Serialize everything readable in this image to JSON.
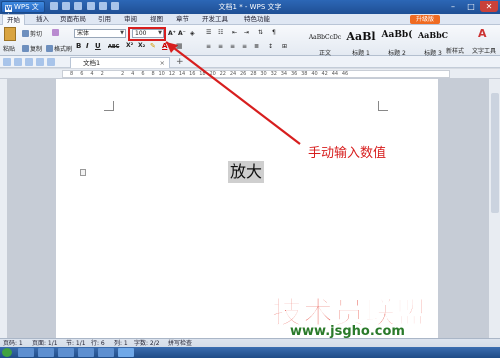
{
  "app": {
    "button_label": "WPS 文字",
    "document_title": "文档1 * - WPS 文字"
  },
  "window_controls": {
    "minimize": "–",
    "maximize": "□",
    "close": "✕"
  },
  "ribbon_tabs": [
    "开始",
    "插入",
    "页面布局",
    "引用",
    "审阅",
    "视图",
    "章节",
    "开发工具",
    "特色功能"
  ],
  "upgrade_label": "升级版",
  "clipboard": {
    "paste": "粘贴",
    "cut": "剪切",
    "copy": "复制",
    "format_painter": "格式刷"
  },
  "font": {
    "name": "宋体",
    "size": "100"
  },
  "format_buttons": [
    "B",
    "I",
    "U",
    "ABC",
    "X²",
    "X₂",
    "A"
  ],
  "styles": [
    {
      "sample": "AaBbCcDc",
      "label": "正文"
    },
    {
      "sample": "AaBl",
      "label": "标题 1"
    },
    {
      "sample": "AaBb(",
      "label": "标题 2"
    },
    {
      "sample": "AaBbC",
      "label": "标题 3"
    }
  ],
  "new_style_label": "新样式",
  "text_tool_label": "文字工具",
  "doc_tab": {
    "name": "文档1",
    "close": "×",
    "new": "+"
  },
  "ruler_marks": [
    "8",
    "6",
    "4",
    "2",
    "",
    "2",
    "4",
    "6",
    "8",
    "10",
    "12",
    "14",
    "16",
    "18",
    "20",
    "22",
    "24",
    "26",
    "28",
    "30",
    "32",
    "34",
    "36",
    "38",
    "40",
    "42",
    "44",
    "46"
  ],
  "document": {
    "body_text": "放大"
  },
  "annotation": {
    "text": "手动输入数值",
    "color": "#d71e1e"
  },
  "status_bar": {
    "page": "页码: 1",
    "pages": "页面: 1/1",
    "section": "节: 1/1",
    "row": "行: 6",
    "col": "列: 1",
    "words": "字数: 2/2",
    "spellcheck": "拼写检查"
  },
  "watermark": {
    "text": "技术员联盟",
    "url": "www.jsgho.com"
  },
  "colors": {
    "title_bar": "#2c67b6",
    "accent": "#f06b21",
    "highlight_box": "#d71e1e"
  }
}
